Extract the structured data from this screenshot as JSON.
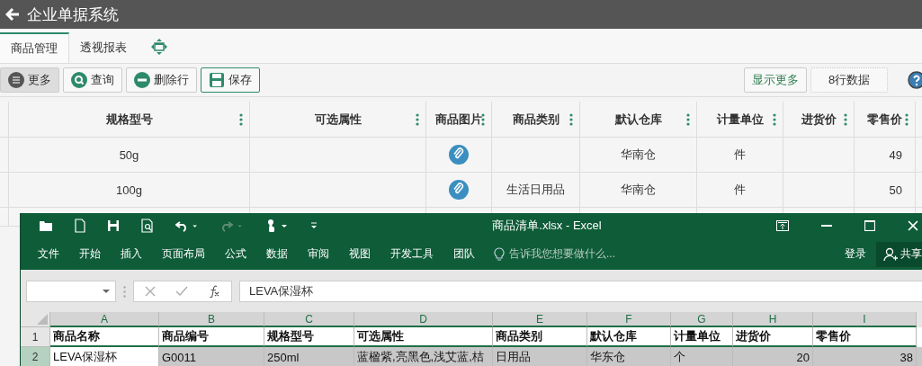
{
  "app_bar": {
    "title": "企业单据系统"
  },
  "tabs": [
    {
      "label": "商品管理",
      "selected": true
    },
    {
      "label": "透视报表",
      "selected": false
    }
  ],
  "toolbar": {
    "buttons": [
      {
        "label": "更多",
        "kind": "more"
      },
      {
        "label": "查询",
        "kind": "search"
      },
      {
        "label": "删除行",
        "kind": "delete"
      },
      {
        "label": "保存",
        "kind": "save"
      }
    ],
    "show_more": "显示更多",
    "row_count": "8行数据"
  },
  "table": {
    "columns": [
      "规格型号",
      "可选属性",
      "商品图片",
      "商品类别",
      "默认仓库",
      "计量单位",
      "进货价",
      "零售价"
    ],
    "rows": [
      {
        "spec": "50g",
        "attr": "",
        "category": "",
        "warehouse": "华南仓",
        "unit": "件",
        "cost": "",
        "price": "49"
      },
      {
        "spec": "100g",
        "attr": "",
        "category": "生活日用品",
        "warehouse": "华南仓",
        "unit": "件",
        "cost": "",
        "price": "50"
      }
    ]
  },
  "excel": {
    "title": "商品清单.xlsx - Excel",
    "ribbon_tabs": [
      "文件",
      "开始",
      "插入",
      "页面布局",
      "公式",
      "数据",
      "审阅",
      "视图",
      "开发工具",
      "团队"
    ],
    "tell_me": {
      "placeholder": "告诉我您想要做什么..."
    },
    "login": "登录",
    "share": "共享",
    "formula": {
      "value": "LEVA保湿杯"
    },
    "column_letters": [
      "A",
      "B",
      "C",
      "D",
      "E",
      "F",
      "G",
      "H",
      "I"
    ],
    "rows": [
      {
        "number": "1",
        "header": true,
        "cells": [
          "商品名称",
          "商品编号",
          "规格型号",
          "可选属性",
          "商品类别",
          "默认仓库",
          "计量单位",
          "进货价",
          "零售价"
        ]
      },
      {
        "number": "2",
        "header": false,
        "cells": [
          "LEVA保湿杯",
          "G0011",
          "250ml",
          "蓝楹紫,亮黑色,浅艾蓝,桔",
          "日用品",
          "华东仓",
          "个",
          "20",
          "38"
        ]
      }
    ]
  }
}
